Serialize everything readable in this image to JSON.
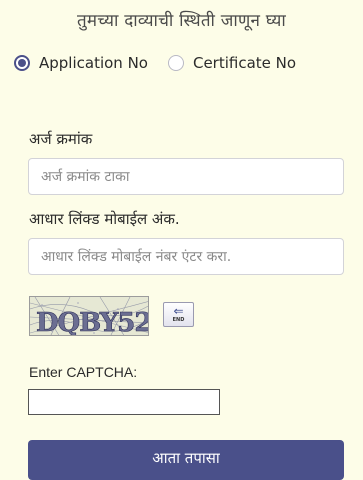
{
  "page_title": "तुमच्या दाव्याची स्थिती जाणून घ्या",
  "search_type": {
    "options": [
      {
        "label": "Application No",
        "checked": true
      },
      {
        "label": "Certificate No",
        "checked": false
      }
    ]
  },
  "application_number": {
    "label": "अर्ज क्रमांक",
    "placeholder": "अर्ज क्रमांक टाका",
    "value": ""
  },
  "aadhaar_mobile": {
    "label": "आधार लिंक्ड मोबाईल अंक.",
    "placeholder": "आधार लिंक्ड मोबाईल नंबर एंटर करा.",
    "value": ""
  },
  "captcha": {
    "image_text": "DQBY52",
    "refresh_icon": "back-arrow-icon",
    "refresh_text": "END",
    "label": "Enter CAPTCHA:",
    "value": ""
  },
  "submit": {
    "label": "आता तपासा"
  },
  "colors": {
    "background": "#fdfde8",
    "accent": "#4a508a",
    "input_border": "#d3d3d8"
  }
}
